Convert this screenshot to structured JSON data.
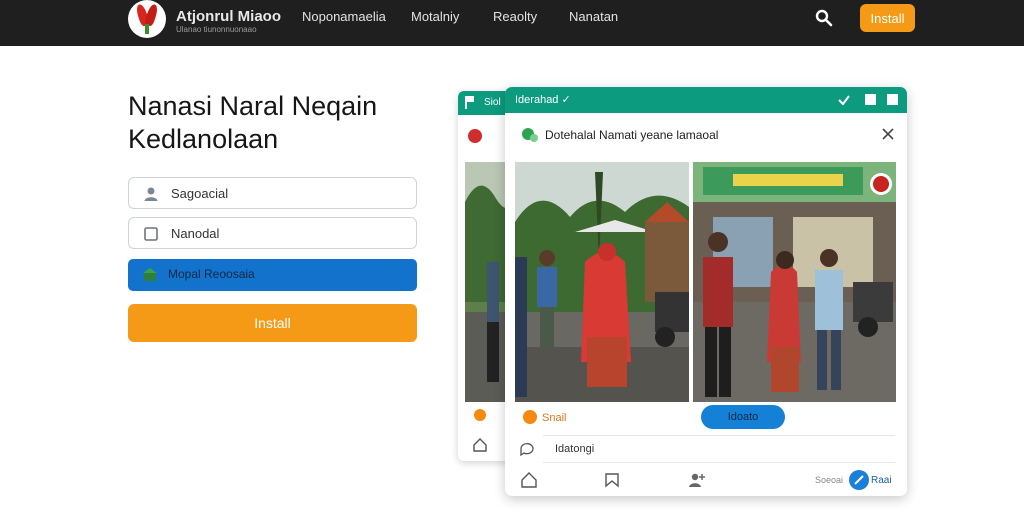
{
  "navbar": {
    "brand_title": "Atjonrul Miaoo",
    "brand_subtitle": "Ulanao tiunonnuonaao",
    "links": [
      "Noponamaelia",
      "Motalniy",
      "Reaolty",
      "Nanatan"
    ],
    "install_label": "Install",
    "search_icon": "search-icon",
    "colors": {
      "background": "#1f1f1f",
      "accent": "#f59a16"
    }
  },
  "hero": {
    "title_line1": "Nanasi Naral Neqain",
    "title_line2": "Kedlanolaan"
  },
  "form": {
    "field1_text": "Sagoacial",
    "field2_text": "Nanodal",
    "blue_button_label": "Mopal Reoosaia",
    "install_button_label": "Install",
    "colors": {
      "primary": "#1272cc",
      "accent": "#f59a16"
    }
  },
  "back_window": {
    "title": "Siol"
  },
  "front_window": {
    "title": "Iderahad ✓",
    "dialog_title": "Dotehalal Namati yeane lamaoal",
    "photo_left_alt": "people in village",
    "photo_right_alt": "people at shop front",
    "small_label": "Snail",
    "pill_label": "Idoato",
    "comment_text": "Idatongi",
    "nav_label_1": "Soeoai",
    "nav_label_2": "Raai",
    "colors": {
      "header": "#0c9b7f",
      "pill": "#1480d6"
    }
  }
}
